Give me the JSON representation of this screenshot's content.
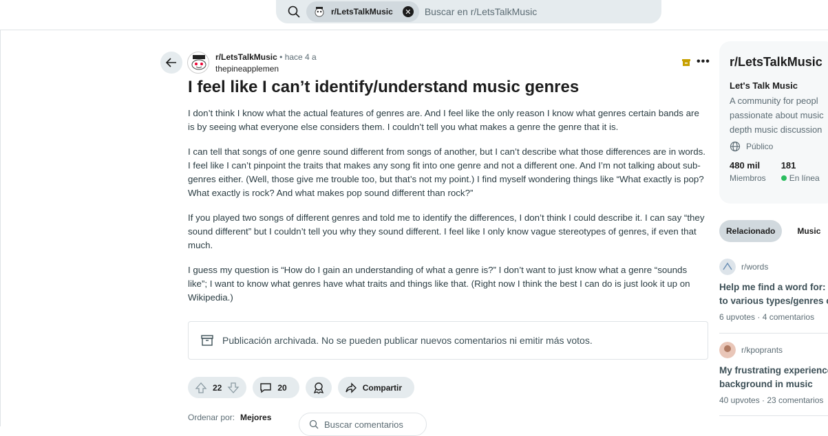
{
  "search": {
    "chip_label": "r/LetsTalkMusic",
    "placeholder": "Buscar en r/LetsTalkMusic"
  },
  "post": {
    "subreddit": "r/LetsTalkMusic",
    "time": "• hace 4 a",
    "author": "thepineapplemen",
    "title": "I feel like I can’t identify/understand music genres",
    "paragraphs": [
      "I don’t think I know what the actual features of genres are. And I feel like the only reason I know what genres certain bands are is by seeing what everyone else considers them. I couldn’t tell you what makes a genre the genre that it is.",
      "I can tell that songs of one genre sound different from songs of another, but I can’t describe what those differences are in words. I feel like I can’t pinpoint the traits that makes any song fit into one genre and not a different one. And I’m not talking about sub-genres either. (Well, those give me trouble too, but that’s not my point.) I find myself wondering things like “What exactly is pop? What exactly is rock? And what makes pop sound different than rock?”",
      "If you played two songs of different genres and told me to identify the differences, I don’t think I could describe it. I can say “they sound different” but I couldn’t tell you why they sound different. I feel like I only know vague stereotypes of genres, if even that much.",
      "I guess my question is “How do I gain an understanding of what a genre is?” I don’t want to just know what a genre “sounds like”; I want to know what genres have what traits and things like that. (Right now I think the best I can do is just look it up on Wikipedia.)"
    ],
    "archived_notice": "Publicación archivada. No se pueden publicar nuevos comentarios ni emitir más votos.",
    "votes": "22",
    "comments": "20",
    "share_label": "Compartir",
    "sort_label": "Ordenar por:",
    "sort_value": "Mejores",
    "comment_search_placeholder": "Buscar comentarios"
  },
  "sidebar": {
    "community": "r/LetsTalkMusic",
    "name": "Let's Talk Music",
    "description_lines": [
      "A community for peopl",
      "passionate about music",
      "depth music discussion"
    ],
    "visibility": "Público",
    "members_count": "480 mil",
    "members_label": "Miembros",
    "online_count": "181",
    "online_label": "En línea",
    "tabs": [
      "Relacionado",
      "Music"
    ],
    "related": [
      {
        "sub": "r/words",
        "title_lines": [
          "Help me find a word for:",
          "to various types/genres c"
        ],
        "stats": "6 upvotes  ·  4 comentarios"
      },
      {
        "sub": "r/kpoprants",
        "title_lines": [
          "My frustrating experience",
          "background in music"
        ],
        "stats": "40 upvotes  ·  23 comentarios"
      }
    ]
  }
}
